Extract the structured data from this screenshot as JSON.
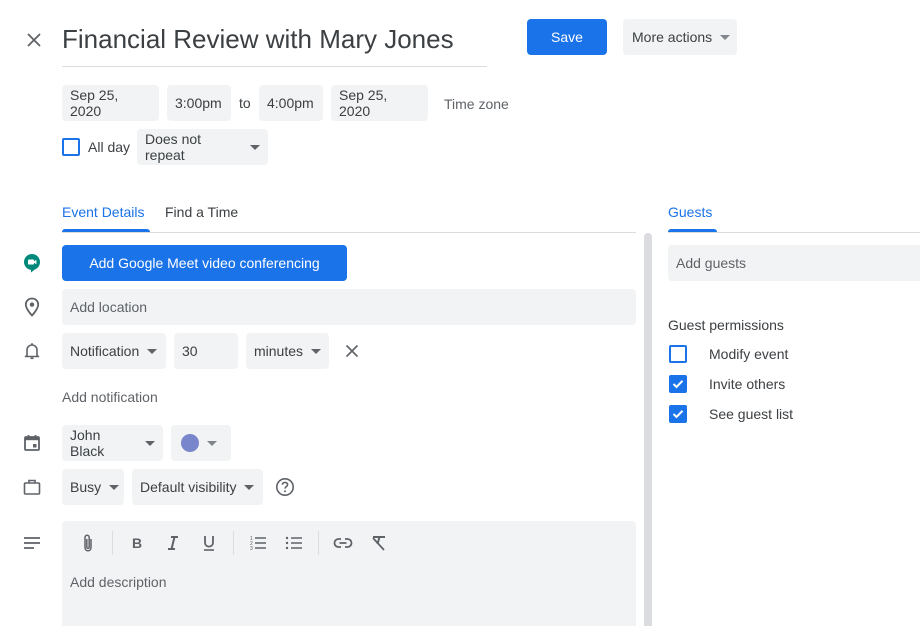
{
  "header": {
    "title": "Financial Review with Mary Jones",
    "save_label": "Save",
    "more_actions_label": "More actions"
  },
  "datetime": {
    "start_date": "Sep 25, 2020",
    "start_time": "3:00pm",
    "to_label": "to",
    "end_time": "4:00pm",
    "end_date": "Sep 25, 2020",
    "time_zone_label": "Time zone",
    "all_day_label": "All day",
    "all_day_checked": false,
    "repeat_label": "Does not repeat"
  },
  "tabs": {
    "event_details": "Event Details",
    "find_a_time": "Find a Time",
    "active": "event_details"
  },
  "details": {
    "meet_button_label": "Add Google Meet video conferencing",
    "location_placeholder": "Add location",
    "notification": {
      "type": "Notification",
      "value": "30",
      "unit": "minutes"
    },
    "add_notification_label": "Add notification",
    "calendar_owner": "John Black",
    "calendar_color": "#7986cb",
    "availability": "Busy",
    "visibility": "Default visibility",
    "description_placeholder": "Add description"
  },
  "guests": {
    "tab_label": "Guests",
    "add_guests_placeholder": "Add guests",
    "permissions_title": "Guest permissions",
    "permissions": [
      {
        "label": "Modify event",
        "checked": false
      },
      {
        "label": "Invite others",
        "checked": true
      },
      {
        "label": "See guest list",
        "checked": true
      }
    ]
  },
  "colors": {
    "accent": "#1a73e8",
    "chip_bg": "#f1f3f4",
    "meet_green": "#00897b"
  }
}
